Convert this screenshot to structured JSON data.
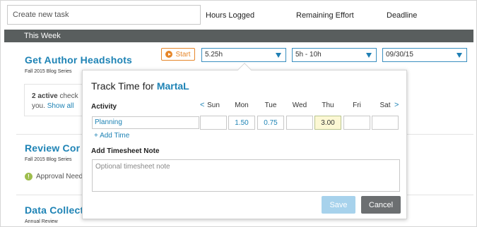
{
  "header": {
    "new_task_placeholder": "Create new task",
    "columns": [
      "Hours Logged",
      "Remaining Effort",
      "Deadline"
    ]
  },
  "week_label": "This Week",
  "tasks": [
    {
      "title": "Get Author Headshots",
      "subtitle": "Fall 2015 Blog Series",
      "start_label": "Start",
      "hours_logged": "5.25h",
      "remaining_effort": "5h - 10h",
      "deadline": "09/30/15",
      "checklist_count": "2 active",
      "checklist_text": "check",
      "checklist_text2": "you.",
      "show_all": "Show all"
    },
    {
      "title": "Review Cor",
      "subtitle": "Fall 2015 Blog Series",
      "approval_text": "Approval Need"
    },
    {
      "title": "Data Collect",
      "subtitle": "Annual Review"
    }
  ],
  "popup": {
    "title_prefix": "Track Time for",
    "user": "MartaL",
    "activity_label": "Activity",
    "prev_arrow": "<",
    "next_arrow": ">",
    "days": [
      "Sun",
      "Mon",
      "Tue",
      "Wed",
      "Thu",
      "Fri",
      "Sat"
    ],
    "activity_value": "Planning",
    "hours": [
      "",
      "1.50",
      "0.75",
      "",
      "3.00",
      "",
      ""
    ],
    "add_time": "+ Add Time",
    "note_label": "Add Timesheet Note",
    "note_placeholder": "Optional timesheet note",
    "save_label": "Save",
    "cancel_label": "Cancel"
  },
  "colors": {
    "accent": "#1e83b5",
    "start": "#e6862a",
    "week_bar": "#595e5e",
    "save_button": "#a7d2ec",
    "cancel_button": "#6c6f71"
  }
}
